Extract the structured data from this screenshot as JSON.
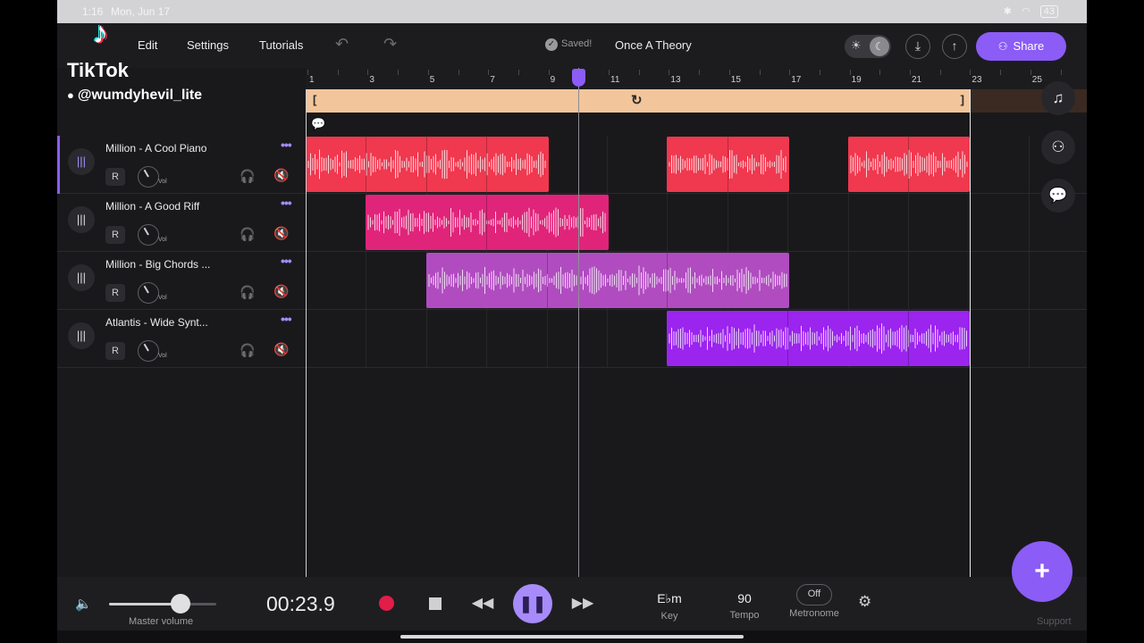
{
  "status": {
    "time": "1:16",
    "date": "Mon, Jun 17",
    "battery": "43"
  },
  "watermark": {
    "brand": "TikTok",
    "handle": "@wumdyhevil_lite"
  },
  "menu": {
    "edit": "Edit",
    "settings": "Settings",
    "tutorials": "Tutorials"
  },
  "project": {
    "saved": "Saved!",
    "title": "Once A Theory"
  },
  "share_label": "Share",
  "ruler": [
    "1",
    "3",
    "5",
    "7",
    "9",
    "11",
    "13",
    "15",
    "17",
    "19",
    "21",
    "23",
    "25"
  ],
  "tracks": [
    {
      "name": "Million - A Cool Piano",
      "record": "R",
      "vol": "Vol",
      "color": "#f0384f"
    },
    {
      "name": "Million - A Good Riff",
      "record": "R",
      "vol": "Vol",
      "color": "#e0247a"
    },
    {
      "name": "Million - Big Chords ...",
      "record": "R",
      "vol": "Vol",
      "color": "#b04cc0"
    },
    {
      "name": "Atlantis - Wide Synt...",
      "record": "R",
      "vol": "Vol",
      "color": "#9b24ee"
    }
  ],
  "transport": {
    "master_volume_label": "Master volume",
    "master_volume_level": 0.67,
    "time": "00:23.9",
    "key_value": "E♭m",
    "key_label": "Key",
    "tempo_value": "90",
    "tempo_label": "Tempo",
    "metronome_value": "Off",
    "metronome_label": "Metronome",
    "support": "Support"
  }
}
